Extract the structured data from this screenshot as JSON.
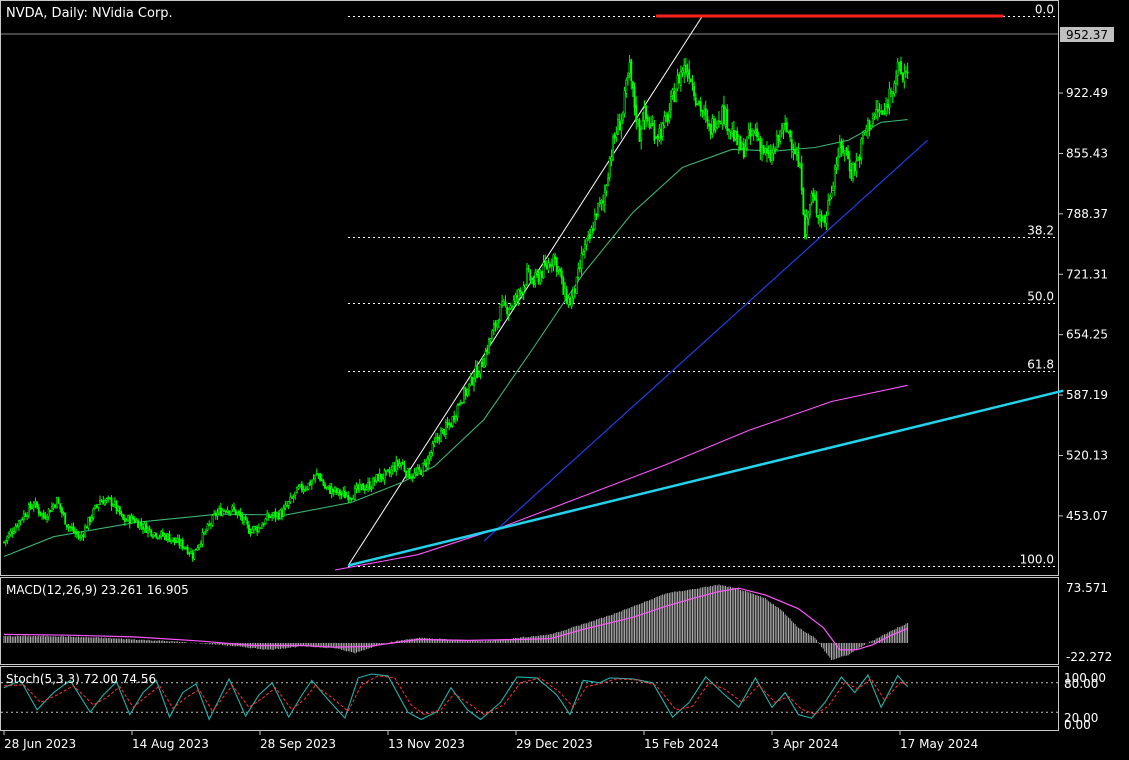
{
  "window": {
    "title": "NVDA, Daily:  NVidia Corp."
  },
  "colors": {
    "background": "#000000",
    "frame": "#c8c8c8",
    "text": "#ffffff",
    "candle_up_body": "#000000",
    "candle_down_body": "#00ff00",
    "candle_wick": "#00ff00",
    "ma_fast": "#3cb371",
    "ma_slow": "#ff55ff",
    "trend_line_main": "#22d3ee",
    "trend_line_support": "#1f3fe6",
    "resistance_line": "#ff2020",
    "fib_line": "#ffffff",
    "macd_hist": "#c0c0c0",
    "macd_signal": "#ff55ff",
    "stoch_main": "#20b2aa",
    "stoch_signal": "#ff3030",
    "level_line": "#c0c0c0"
  },
  "chart_data": [
    {
      "type": "candlestick",
      "pane": "price",
      "symbol": "NVDA",
      "timeframe": "Daily",
      "ylim": [
        393,
        1008
      ],
      "yticks": [
        "922.49",
        "855.43",
        "788.37",
        "721.31",
        "654.25",
        "587.19",
        "520.13",
        "453.07"
      ],
      "current_price_label": "952.37",
      "xlabels": [
        "28 Jun 2023",
        "14 Aug 2023",
        "28 Sep 2023",
        "13 Nov 2023",
        "29 Dec 2023",
        "15 Feb 2024",
        "3 Apr 2024",
        "17 May 2024"
      ],
      "close_path": [
        [
          0,
          424
        ],
        [
          10,
          450
        ],
        [
          18,
          467
        ],
        [
          24,
          452
        ],
        [
          32,
          470
        ],
        [
          38,
          444
        ],
        [
          42,
          436
        ],
        [
          46,
          428
        ],
        [
          52,
          450
        ],
        [
          58,
          471
        ],
        [
          66,
          468
        ],
        [
          72,
          448
        ],
        [
          78,
          450
        ],
        [
          82,
          444
        ],
        [
          90,
          435
        ],
        [
          94,
          432
        ],
        [
          99,
          430
        ],
        [
          104,
          424
        ],
        [
          109,
          420
        ],
        [
          114,
          410
        ],
        [
          118,
          424
        ],
        [
          124,
          442
        ],
        [
          128,
          455
        ],
        [
          134,
          462
        ],
        [
          138,
          460
        ],
        [
          142,
          454
        ],
        [
          148,
          438
        ],
        [
          154,
          440
        ],
        [
          160,
          452
        ],
        [
          168,
          456
        ],
        [
          174,
          472
        ],
        [
          178,
          482
        ],
        [
          184,
          488
        ],
        [
          190,
          500
        ],
        [
          194,
          484
        ],
        [
          200,
          480
        ],
        [
          206,
          476
        ],
        [
          210,
          477
        ],
        [
          216,
          484
        ],
        [
          222,
          488
        ],
        [
          226,
          496
        ],
        [
          232,
          498
        ],
        [
          236,
          508
        ],
        [
          240,
          512
        ],
        [
          244,
          500
        ],
        [
          248,
          498
        ],
        [
          252,
          504
        ],
        [
          256,
          515
        ],
        [
          262,
          540
        ],
        [
          266,
          548
        ],
        [
          270,
          556
        ],
        [
          276,
          584
        ],
        [
          280,
          592
        ],
        [
          284,
          610
        ],
        [
          288,
          618
        ],
        [
          292,
          640
        ],
        [
          296,
          660
        ],
        [
          300,
          682
        ],
        [
          304,
          685
        ],
        [
          308,
          690
        ],
        [
          312,
          702
        ],
        [
          316,
          720
        ],
        [
          320,
          712
        ],
        [
          324,
          722
        ],
        [
          328,
          730
        ],
        [
          332,
          742
        ],
        [
          336,
          722
        ],
        [
          338,
          700
        ],
        [
          342,
          690
        ],
        [
          346,
          710
        ],
        [
          350,
          748
        ],
        [
          354,
          760
        ],
        [
          358,
          792
        ],
        [
          362,
          800
        ],
        [
          366,
          850
        ],
        [
          370,
          880
        ],
        [
          374,
          900
        ],
        [
          376,
          928
        ],
        [
          378,
          948
        ],
        [
          380,
          920
        ],
        [
          384,
          876
        ],
        [
          386,
          900
        ],
        [
          390,
          888
        ],
        [
          394,
          878
        ],
        [
          398,
          882
        ],
        [
          402,
          902
        ],
        [
          406,
          930
        ],
        [
          410,
          950
        ],
        [
          414,
          948
        ],
        [
          418,
          920
        ],
        [
          422,
          902
        ],
        [
          426,
          880
        ],
        [
          430,
          895
        ],
        [
          434,
          902
        ],
        [
          438,
          888
        ],
        [
          442,
          870
        ],
        [
          446,
          858
        ],
        [
          450,
          872
        ],
        [
          454,
          880
        ],
        [
          458,
          862
        ],
        [
          462,
          848
        ],
        [
          466,
          860
        ],
        [
          470,
          882
        ],
        [
          474,
          880
        ],
        [
          478,
          860
        ],
        [
          482,
          824
        ],
        [
          484,
          770
        ],
        [
          488,
          808
        ],
        [
          492,
          790
        ],
        [
          496,
          780
        ],
        [
          500,
          820
        ],
        [
          504,
          856
        ],
        [
          508,
          862
        ],
        [
          512,
          836
        ],
        [
          516,
          848
        ],
        [
          520,
          880
        ],
        [
          524,
          892
        ],
        [
          528,
          902
        ],
        [
          532,
          898
        ],
        [
          536,
          930
        ],
        [
          540,
          948
        ],
        [
          543,
          940
        ],
        [
          546,
          952
        ]
      ],
      "overlays": {
        "ma_fast_path": [
          [
            0,
            408
          ],
          [
            30,
            430
          ],
          [
            80,
            446
          ],
          [
            130,
            455
          ],
          [
            170,
            454
          ],
          [
            210,
            468
          ],
          [
            240,
            490
          ],
          [
            260,
            508
          ],
          [
            290,
            560
          ],
          [
            320,
            640
          ],
          [
            350,
            722
          ],
          [
            380,
            790
          ],
          [
            410,
            840
          ],
          [
            440,
            860
          ],
          [
            466,
            858
          ],
          [
            490,
            862
          ],
          [
            510,
            870
          ],
          [
            530,
            890
          ],
          [
            546,
            893
          ]
        ],
        "ma_slow_path": [
          [
            200,
            393
          ],
          [
            250,
            410
          ],
          [
            300,
            440
          ],
          [
            350,
            475
          ],
          [
            400,
            510
          ],
          [
            450,
            548
          ],
          [
            500,
            580
          ],
          [
            546,
            598
          ]
        ],
        "trend_line_main": [
          [
            208,
            398
          ],
          [
            640,
            592
          ]
        ],
        "trend_line_support": [
          [
            290,
            425
          ],
          [
            558,
            870
          ]
        ],
        "resistance_line": [
          [
            394,
            1008
          ],
          [
            604,
            1008
          ]
        ],
        "swing_line": [
          [
            208,
            398
          ],
          [
            422,
            1008
          ]
        ]
      },
      "fib_levels": [
        {
          "label": "0.0",
          "price": 1008
        },
        {
          "label": "38.2",
          "price": 763
        },
        {
          "label": "50.0",
          "price": 689
        },
        {
          "label": "61.8",
          "price": 614
        },
        {
          "label": "100.0",
          "price": 397
        }
      ]
    },
    {
      "type": "histogram",
      "pane": "macd",
      "label": "MACD(12,26,9) 23.261 16.905",
      "ylim": [
        -22.272,
        73.571
      ],
      "yticks": [
        "73.571",
        "-22.272"
      ],
      "macd_path": [
        [
          0,
          8
        ],
        [
          30,
          8
        ],
        [
          60,
          6
        ],
        [
          100,
          2
        ],
        [
          130,
          -2
        ],
        [
          160,
          -8
        ],
        [
          180,
          -4
        ],
        [
          200,
          -6
        ],
        [
          212,
          -12
        ],
        [
          230,
          0
        ],
        [
          250,
          6
        ],
        [
          270,
          4
        ],
        [
          290,
          2
        ],
        [
          310,
          6
        ],
        [
          330,
          10
        ],
        [
          350,
          22
        ],
        [
          370,
          35
        ],
        [
          390,
          50
        ],
        [
          400,
          58
        ],
        [
          420,
          64
        ],
        [
          432,
          68
        ],
        [
          444,
          63
        ],
        [
          460,
          52
        ],
        [
          470,
          38
        ],
        [
          480,
          18
        ],
        [
          490,
          6
        ],
        [
          500,
          -20
        ],
        [
          510,
          -14
        ],
        [
          520,
          -2
        ],
        [
          530,
          8
        ],
        [
          540,
          18
        ],
        [
          546,
          23
        ]
      ],
      "signal_path": [
        [
          0,
          10
        ],
        [
          40,
          9
        ],
        [
          80,
          7
        ],
        [
          120,
          2
        ],
        [
          150,
          -3
        ],
        [
          180,
          -3
        ],
        [
          200,
          -5
        ],
        [
          220,
          -4
        ],
        [
          250,
          4
        ],
        [
          280,
          3
        ],
        [
          310,
          4
        ],
        [
          330,
          5
        ],
        [
          350,
          16
        ],
        [
          380,
          30
        ],
        [
          400,
          43
        ],
        [
          420,
          54
        ],
        [
          432,
          60
        ],
        [
          444,
          64
        ],
        [
          460,
          56
        ],
        [
          480,
          40
        ],
        [
          495,
          18
        ],
        [
          505,
          -8
        ],
        [
          515,
          -8
        ],
        [
          525,
          -2
        ],
        [
          535,
          8
        ],
        [
          546,
          17
        ]
      ]
    },
    {
      "type": "line",
      "pane": "stochastic",
      "label": "Stoch(5,3,3) 72.00 74.56",
      "ylim": [
        0,
        100
      ],
      "yticks": [
        "100.00",
        "80.00",
        "20.00",
        "0.00"
      ],
      "levels": [
        80,
        20
      ],
      "k_path": [
        [
          0,
          70
        ],
        [
          10,
          85
        ],
        [
          20,
          25
        ],
        [
          30,
          60
        ],
        [
          40,
          85
        ],
        [
          52,
          20
        ],
        [
          60,
          55
        ],
        [
          68,
          82
        ],
        [
          76,
          15
        ],
        [
          84,
          60
        ],
        [
          92,
          85
        ],
        [
          100,
          10
        ],
        [
          108,
          60
        ],
        [
          116,
          78
        ],
        [
          124,
          5
        ],
        [
          136,
          88
        ],
        [
          146,
          12
        ],
        [
          154,
          55
        ],
        [
          162,
          80
        ],
        [
          172,
          10
        ],
        [
          180,
          55
        ],
        [
          186,
          85
        ],
        [
          196,
          45
        ],
        [
          206,
          8
        ],
        [
          214,
          90
        ],
        [
          222,
          98
        ],
        [
          232,
          94
        ],
        [
          244,
          20
        ],
        [
          252,
          5
        ],
        [
          262,
          22
        ],
        [
          270,
          70
        ],
        [
          280,
          25
        ],
        [
          288,
          5
        ],
        [
          300,
          40
        ],
        [
          310,
          92
        ],
        [
          322,
          90
        ],
        [
          334,
          55
        ],
        [
          342,
          15
        ],
        [
          350,
          85
        ],
        [
          360,
          80
        ],
        [
          366,
          90
        ],
        [
          380,
          88
        ],
        [
          392,
          80
        ],
        [
          404,
          10
        ],
        [
          414,
          40
        ],
        [
          424,
          92
        ],
        [
          434,
          60
        ],
        [
          444,
          30
        ],
        [
          454,
          90
        ],
        [
          464,
          30
        ],
        [
          472,
          60
        ],
        [
          480,
          15
        ],
        [
          488,
          8
        ],
        [
          496,
          40
        ],
        [
          506,
          92
        ],
        [
          514,
          60
        ],
        [
          522,
          96
        ],
        [
          530,
          30
        ],
        [
          540,
          95
        ],
        [
          546,
          72
        ]
      ],
      "d_path": [
        [
          0,
          74
        ],
        [
          12,
          76
        ],
        [
          22,
          40
        ],
        [
          32,
          55
        ],
        [
          42,
          74
        ],
        [
          54,
          35
        ],
        [
          62,
          50
        ],
        [
          70,
          72
        ],
        [
          78,
          30
        ],
        [
          86,
          52
        ],
        [
          94,
          74
        ],
        [
          102,
          28
        ],
        [
          110,
          50
        ],
        [
          118,
          66
        ],
        [
          126,
          22
        ],
        [
          138,
          75
        ],
        [
          148,
          30
        ],
        [
          156,
          48
        ],
        [
          164,
          70
        ],
        [
          174,
          25
        ],
        [
          182,
          48
        ],
        [
          188,
          74
        ],
        [
          198,
          50
        ],
        [
          208,
          22
        ],
        [
          216,
          76
        ],
        [
          226,
          94
        ],
        [
          236,
          90
        ],
        [
          246,
          35
        ],
        [
          254,
          15
        ],
        [
          264,
          25
        ],
        [
          272,
          58
        ],
        [
          282,
          35
        ],
        [
          290,
          15
        ],
        [
          302,
          35
        ],
        [
          312,
          80
        ],
        [
          324,
          90
        ],
        [
          336,
          60
        ],
        [
          344,
          30
        ],
        [
          352,
          72
        ],
        [
          362,
          80
        ],
        [
          370,
          88
        ],
        [
          382,
          86
        ],
        [
          394,
          75
        ],
        [
          406,
          25
        ],
        [
          416,
          32
        ],
        [
          426,
          80
        ],
        [
          436,
          66
        ],
        [
          446,
          40
        ],
        [
          456,
          75
        ],
        [
          466,
          40
        ],
        [
          474,
          52
        ],
        [
          482,
          26
        ],
        [
          490,
          16
        ],
        [
          498,
          32
        ],
        [
          508,
          80
        ],
        [
          516,
          68
        ],
        [
          524,
          88
        ],
        [
          532,
          45
        ],
        [
          542,
          82
        ],
        [
          546,
          74
        ]
      ]
    }
  ]
}
